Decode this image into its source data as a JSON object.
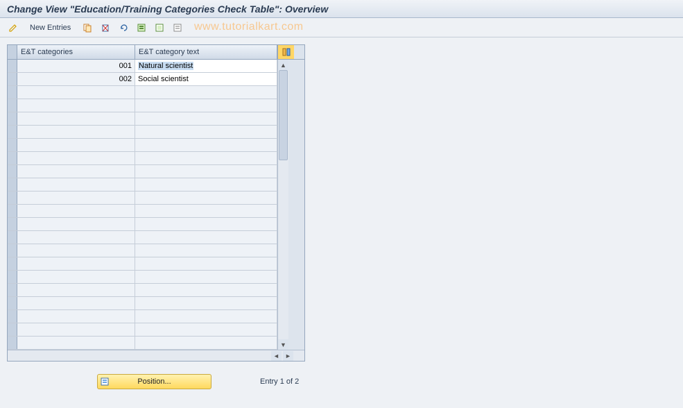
{
  "title": "Change View \"Education/Training Categories Check Table\": Overview",
  "toolbar": {
    "new_entries_label": "New Entries"
  },
  "watermark": "www.tutorialkart.com",
  "table": {
    "columns": {
      "col1": "E&T categories",
      "col2": "E&T category text"
    },
    "rows": [
      {
        "cat": "001",
        "text": "Natural scientist",
        "highlight": true
      },
      {
        "cat": "002",
        "text": "Social scientist",
        "highlight": false
      }
    ]
  },
  "footer": {
    "position_label": "Position...",
    "entry_text": "Entry 1 of 2"
  }
}
